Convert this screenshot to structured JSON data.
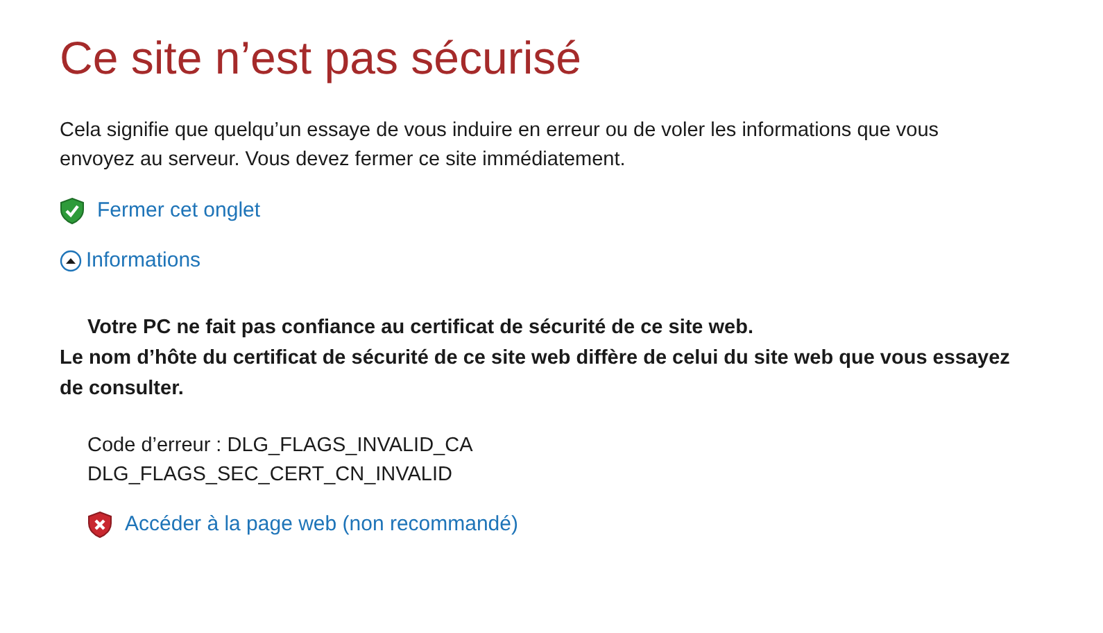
{
  "title": "Ce site n’est pas sécurisé",
  "description": "Cela signifie que quelqu’un essaye de vous induire en erreur ou de voler les informations que vous envoyez au serveur. Vous devez fermer ce site immédiatement.",
  "close_link": "Fermer cet onglet",
  "details_toggle": {
    "label": "Informations",
    "expanded": true
  },
  "details": {
    "heading": "Votre PC ne fait pas confiance au certificat de sécurité de ce site web.",
    "explanation": "Le nom d’hôte du certificat de sécurité de ce site web diffère de celui du site web que vous essayez de consulter.",
    "error_code": "Code d’erreur : DLG_FLAGS_INVALID_CA",
    "error_code_2": "DLG_FLAGS_SEC_CERT_CN_INVALID",
    "proceed_link": "Accéder à la page web (non recommandé)"
  }
}
